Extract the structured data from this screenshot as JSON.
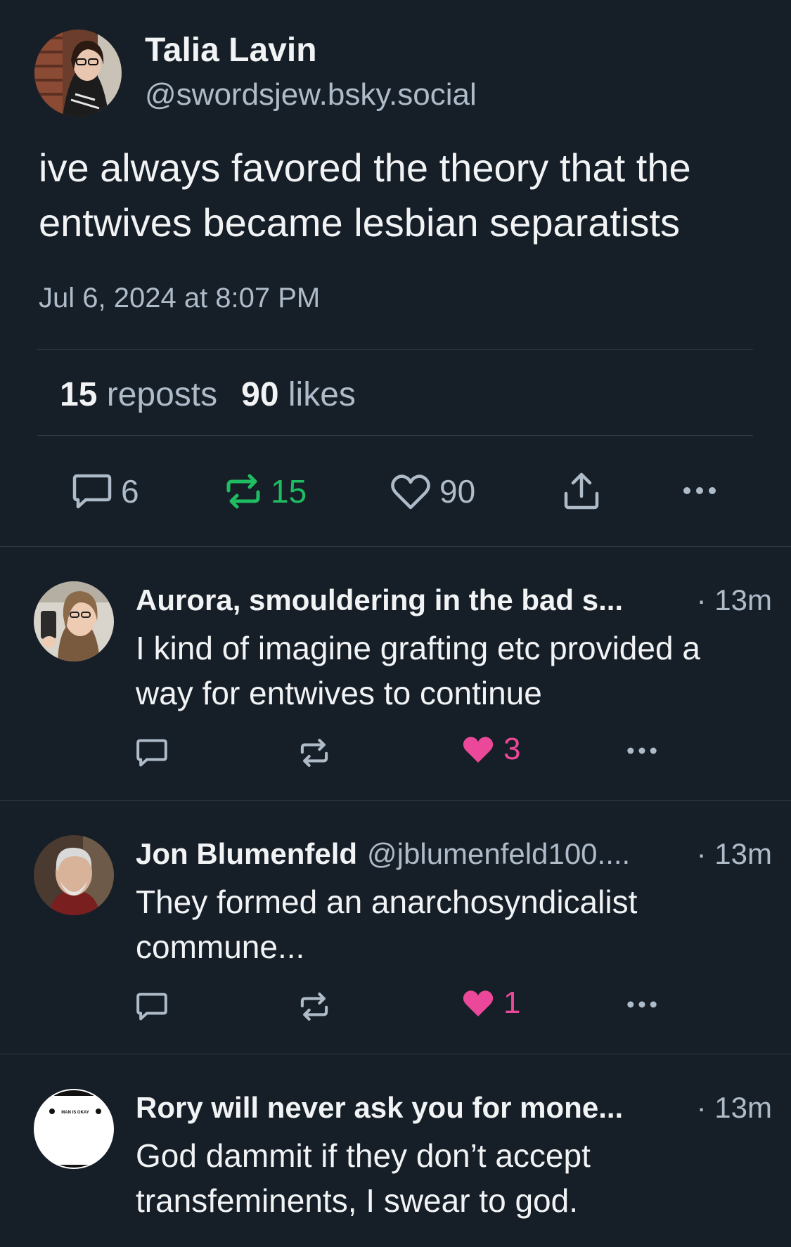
{
  "post": {
    "author_name": "Talia Lavin",
    "author_handle": "@swordsjew.bsky.social",
    "text": "ive always favored the theory that the entwives became lesbian separatists",
    "timestamp": "Jul 6, 2024 at 8:07 PM",
    "repost_count": "15",
    "repost_label": "reposts",
    "like_count": "90",
    "like_label": "likes",
    "actions": {
      "reply_count": "6",
      "repost_count": "15",
      "like_count": "90"
    }
  },
  "replies": [
    {
      "name": "Aurora, smouldering in the bad s...",
      "handle": "",
      "time": "· 13m",
      "text": "I kind of imagine grafting etc provided a way for entwives to continue",
      "like_count": "3"
    },
    {
      "name": "Jon Blumenfeld",
      "handle": "@jblumenfeld100....",
      "time": "· 13m",
      "text": "They formed an anarchosyndicalist commune...",
      "like_count": "1"
    },
    {
      "name": "Rory will never ask you for mone...",
      "handle": "",
      "time": "· 13m",
      "text": "God dammit if they don’t accept transfeminents, I swear to god.",
      "avatar_text": "MAN IS OKAY"
    }
  ],
  "colors": {
    "background": "#161e27",
    "text": "#f1f3f5",
    "muted": "#aebbc9",
    "divider": "#2e3a47",
    "repost_active": "#20bc62",
    "like_active": "#ec4899"
  },
  "icons": [
    "reply-icon",
    "repost-icon",
    "like-icon",
    "share-icon",
    "more-icon"
  ]
}
